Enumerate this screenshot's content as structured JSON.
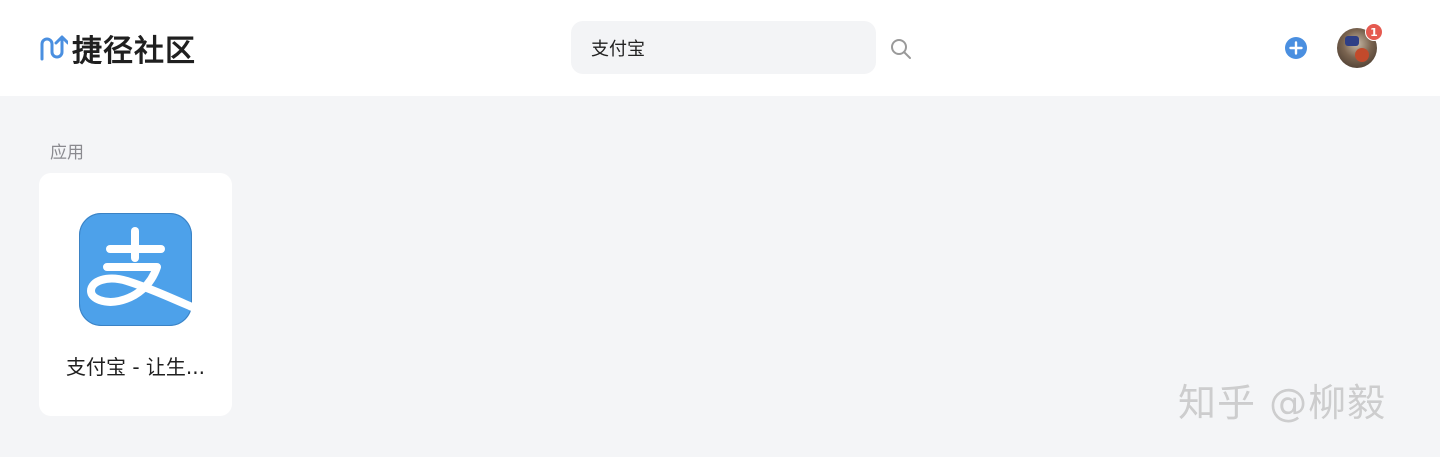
{
  "header": {
    "brand": "捷径社区",
    "search": {
      "value": "支付宝"
    },
    "notification_count": "1"
  },
  "results": {
    "section_label": "应用",
    "apps": [
      {
        "name": "支付宝 - 让生...",
        "icon": "alipay-icon",
        "icon_color": "#4da1ea"
      }
    ]
  },
  "watermark": "知乎 @柳毅",
  "colors": {
    "accent": "#4a8fe0",
    "page_bg": "#f4f5f7",
    "badge": "#e55a50"
  }
}
